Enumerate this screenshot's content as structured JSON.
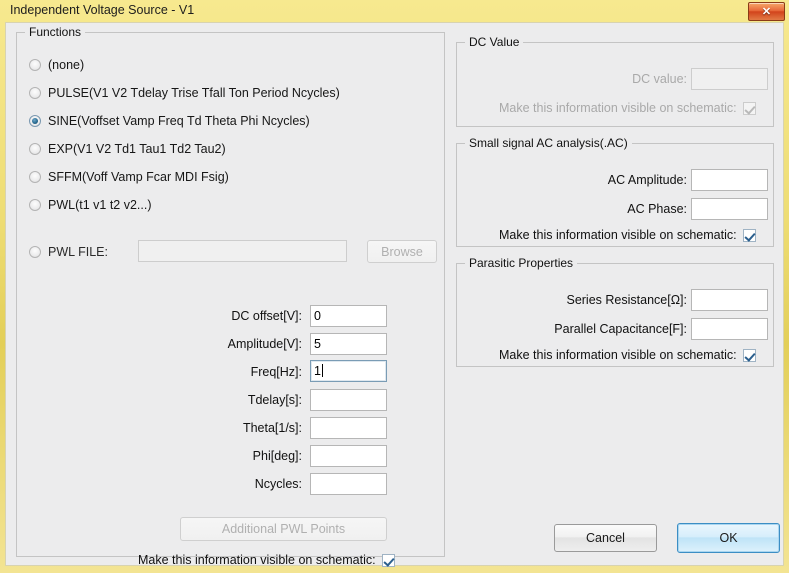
{
  "window": {
    "title": "Independent Voltage Source - V1",
    "close_label": "✕",
    "accent_yellow": "#eedd74",
    "close_red": "#d2441c",
    "default_button_blue": "#3c8ec4"
  },
  "functions": {
    "legend": "Functions",
    "options": [
      {
        "label": "(none)",
        "selected": false
      },
      {
        "label": "PULSE(V1 V2 Tdelay Trise Tfall Ton Period Ncycles)",
        "selected": false
      },
      {
        "label": "SINE(Voffset Vamp Freq Td Theta Phi Ncycles)",
        "selected": true
      },
      {
        "label": "EXP(V1 V2 Td1 Tau1 Td2 Tau2)",
        "selected": false
      },
      {
        "label": "SFFM(Voff Vamp Fcar MDI Fsig)",
        "selected": false
      },
      {
        "label": "PWL(t1 v1 t2 v2...)",
        "selected": false
      },
      {
        "label": "PWL FILE:",
        "selected": false
      }
    ],
    "pwl_file": {
      "value": "",
      "enabled": false
    },
    "browse_label": "Browse",
    "browse_enabled": false,
    "parameters": [
      {
        "label": "DC offset[V]:",
        "value": "0",
        "focused": false
      },
      {
        "label": "Amplitude[V]:",
        "value": "5",
        "focused": false
      },
      {
        "label": "Freq[Hz]:",
        "value": "1",
        "focused": true
      },
      {
        "label": "Tdelay[s]:",
        "value": "",
        "focused": false
      },
      {
        "label": "Theta[1/s]:",
        "value": "",
        "focused": false
      },
      {
        "label": "Phi[deg]:",
        "value": "",
        "focused": false
      },
      {
        "label": "Ncycles:",
        "value": "",
        "focused": false
      }
    ],
    "additional_pwl_label": "Additional PWL Points",
    "additional_pwl_enabled": false,
    "visible_checkbox": {
      "label": "Make this information visible on schematic:",
      "checked": true,
      "enabled": true
    }
  },
  "dc_value": {
    "legend": "DC Value",
    "enabled": false,
    "field_label": "DC value:",
    "field_value": "",
    "visible_checkbox": {
      "label": "Make this information visible on schematic:",
      "checked": true,
      "enabled": false
    }
  },
  "ac_analysis": {
    "legend": "Small signal AC analysis(.AC)",
    "fields": [
      {
        "label": "AC Amplitude:",
        "value": ""
      },
      {
        "label": "AC Phase:",
        "value": ""
      }
    ],
    "visible_checkbox": {
      "label": "Make this information visible on schematic:",
      "checked": true,
      "enabled": true
    }
  },
  "parasitic": {
    "legend": "Parasitic Properties",
    "fields": [
      {
        "label": "Series Resistance[Ω]:",
        "value": ""
      },
      {
        "label": "Parallel Capacitance[F]:",
        "value": ""
      }
    ],
    "visible_checkbox": {
      "label": "Make this information visible on schematic:",
      "checked": true,
      "enabled": true
    }
  },
  "footer": {
    "cancel_label": "Cancel",
    "ok_label": "OK"
  }
}
